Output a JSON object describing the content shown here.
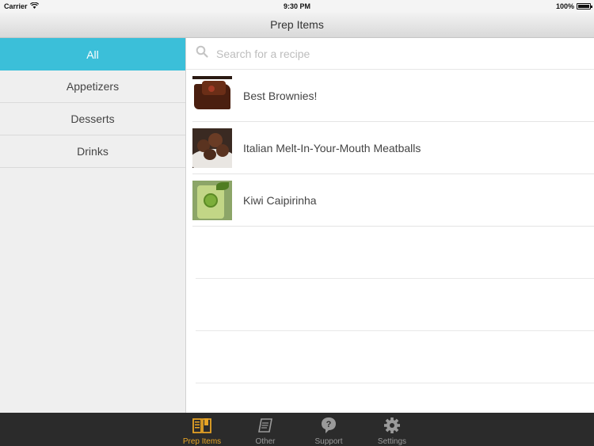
{
  "status_bar": {
    "carrier": "Carrier",
    "time": "9:30 PM",
    "battery": "100%",
    "battery_level": 1.0
  },
  "nav": {
    "title": "Prep Items"
  },
  "sidebar": {
    "items": [
      {
        "label": "All",
        "active": true
      },
      {
        "label": "Appetizers",
        "active": false
      },
      {
        "label": "Desserts",
        "active": false
      },
      {
        "label": "Drinks",
        "active": false
      }
    ]
  },
  "search": {
    "placeholder": "Search for a recipe",
    "value": ""
  },
  "recipes": [
    {
      "name": "Best Brownies!",
      "thumbnail": "brownies-photo"
    },
    {
      "name": "Italian Melt-In-Your-Mouth Meatballs",
      "thumbnail": "meatballs-photo"
    },
    {
      "name": "Kiwi Caipirinha",
      "thumbnail": "caipirinha-photo"
    }
  ],
  "tab_bar": {
    "tabs": [
      {
        "label": "Prep Items",
        "icon": "book-icon",
        "active": true
      },
      {
        "label": "Other",
        "icon": "note-icon",
        "active": false
      },
      {
        "label": "Support",
        "icon": "question-icon",
        "active": false
      },
      {
        "label": "Settings",
        "icon": "gear-icon",
        "active": false
      }
    ]
  },
  "colors": {
    "accent": "#3bbfd9",
    "tab_active": "#e7a425",
    "tab_bar_bg": "#2b2b2b"
  }
}
